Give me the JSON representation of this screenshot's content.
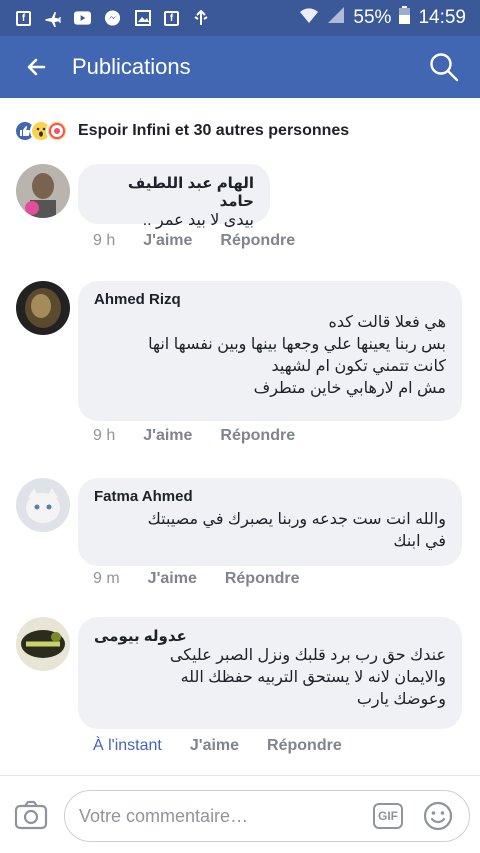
{
  "status_bar": {
    "notif_icons": [
      "facebook-icon",
      "airplane-icon",
      "youtube-icon",
      "messenger-icon",
      "gallery-icon",
      "facebook-icon",
      "usb-icon"
    ],
    "battery": "55%",
    "time": "14:59"
  },
  "app_bar": {
    "title": "Publications"
  },
  "reactions": {
    "summary": "Espoir Infini et 30 autres personnes"
  },
  "comments": [
    {
      "name": "الهام عبد اللطيف حامد",
      "text": "بيدى لا بيد عمر ..",
      "time": "9 h",
      "like": "J'aime",
      "reply": "Répondre"
    },
    {
      "name": "Ahmed Rizq",
      "text": "هي فعلا قالت كده\nبس ربنا يعينها علي وجعها بينها وبين نفسها انها\nكانت تتمني تكون ام لشهيد\nمش ام لارهابي خاين متطرف",
      "time": "9 h",
      "like": "J'aime",
      "reply": "Répondre"
    },
    {
      "name": "Fatma Ahmed",
      "text": "والله انت ست جدعه وربنا يصبرك في مصيبتك\nفي ابنك",
      "time": "9 m",
      "like": "J'aime",
      "reply": "Répondre"
    },
    {
      "name": "عدوله بيومى",
      "text": "عندك حق رب برد قلبك ونزل الصبر عليكى\nوالايمان لانه لا يستحق التربيه حفظك الله\nوعوضك يارب",
      "time": "À l'instant",
      "like": "J'aime",
      "reply": "Répondre"
    }
  ],
  "composer": {
    "placeholder": "Votre commentaire…",
    "gif_label": "GIF"
  },
  "colors": {
    "brand": "#4267b2",
    "status_bar": "#3b5998",
    "bubble": "#f0f1f4",
    "meta": "#90949c"
  }
}
